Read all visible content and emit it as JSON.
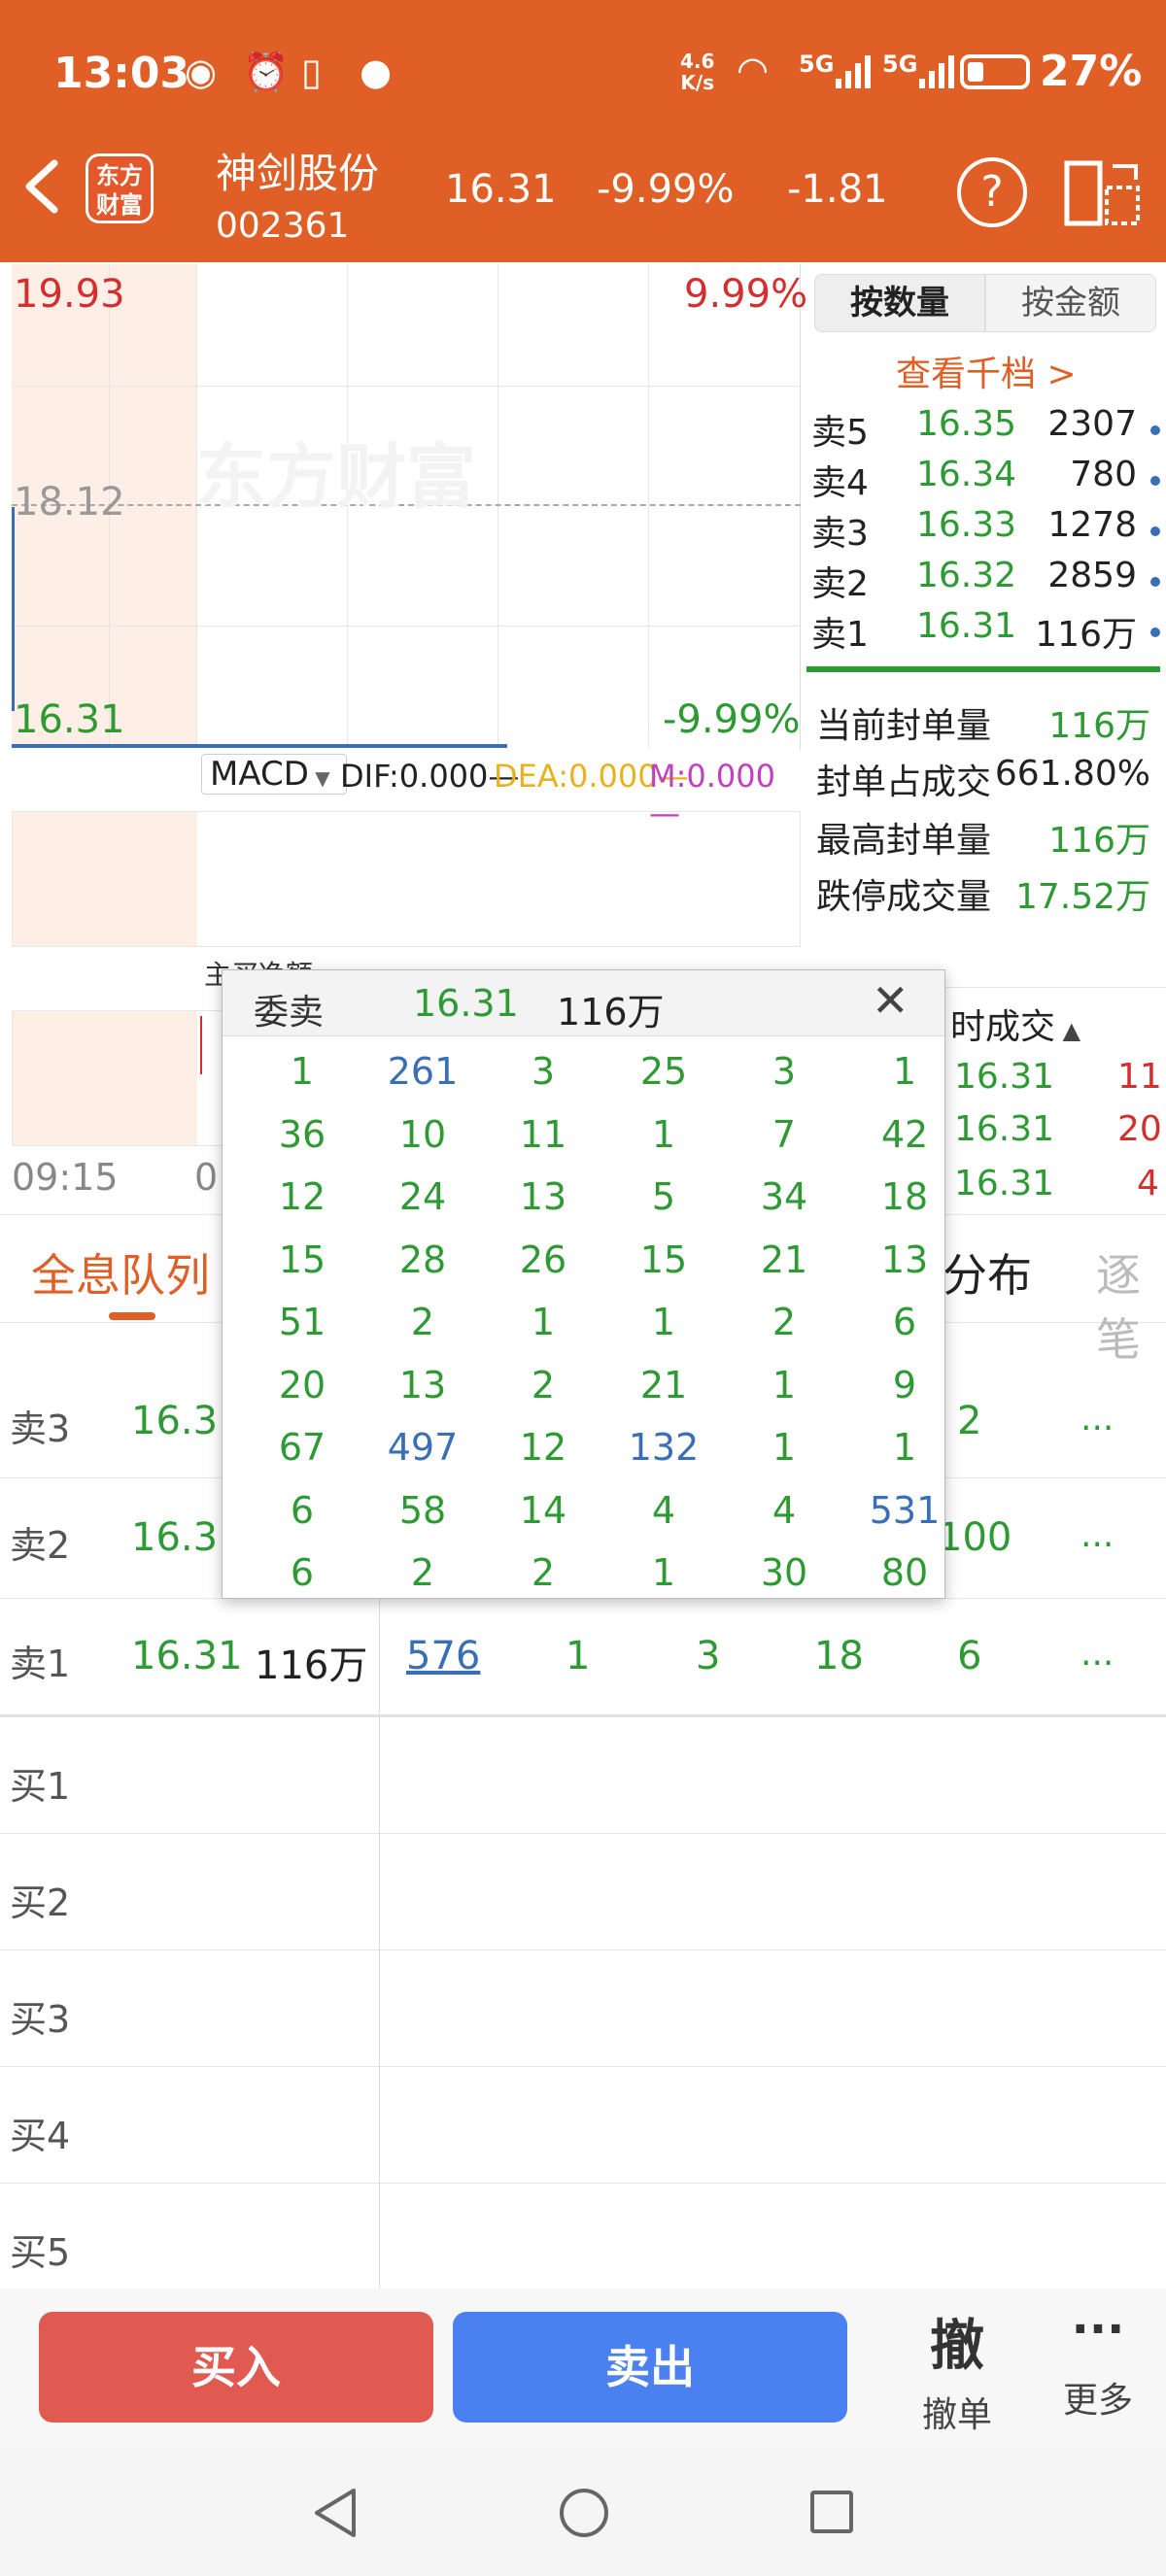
{
  "status_bar": {
    "time": "13:03",
    "net_speed_top": "4.6",
    "net_speed_bottom": "K/s",
    "sim1": "5G",
    "sim2": "5G",
    "battery": "27%"
  },
  "header": {
    "logo_line1": "东方",
    "logo_line2": "财富",
    "stock_name": "神剑股份",
    "stock_code": "002361",
    "price": "16.31",
    "change_pct": "-9.99%",
    "change": "-1.81",
    "help": "?"
  },
  "chart": {
    "y_high": "19.93",
    "y_mid": "18.12",
    "y_low": "16.31",
    "pct_high": "9.99%",
    "pct_low": "-9.99%",
    "watermark": "东方财富",
    "time_start": "09:15",
    "time_partial": "0",
    "indicator": "MACD",
    "dif": "DIF:0.000—",
    "dea": "DEA:0.000—",
    "m": "M:0.000—",
    "sub_partial": "主买净额"
  },
  "orderbook": {
    "tab_qty": "按数量",
    "tab_amt": "按金额",
    "view_link": "查看千档 >",
    "rows": [
      {
        "label": "卖5",
        "price": "16.35",
        "vol": "2307"
      },
      {
        "label": "卖4",
        "price": "16.34",
        "vol": "780"
      },
      {
        "label": "卖3",
        "price": "16.33",
        "vol": "1278"
      },
      {
        "label": "卖2",
        "price": "16.32",
        "vol": "2859"
      },
      {
        "label": "卖1",
        "price": "16.31",
        "vol": "116万"
      }
    ],
    "stats": [
      {
        "label": "当前封单量",
        "value": "116万"
      },
      {
        "label": "封单占成交",
        "value": "661.80%"
      },
      {
        "label": "最高封单量",
        "value": "116万"
      },
      {
        "label": "跌停成交量",
        "value": "17.52万"
      }
    ]
  },
  "realtime": {
    "title": "时成交",
    "rows": [
      {
        "price": "16.31",
        "vol": "11"
      },
      {
        "price": "16.31",
        "vol": "20"
      },
      {
        "price": "16.31",
        "vol": "4"
      }
    ]
  },
  "tabs": {
    "active": "全息队列",
    "mid": "分布",
    "right": "逐笔"
  },
  "queue": {
    "rows": [
      {
        "label": "卖3",
        "price": "16.3",
        "right": "2",
        "more": "..."
      },
      {
        "label": "卖2",
        "price": "16.3",
        "right": "100",
        "more": "..."
      },
      {
        "label": "卖1",
        "price": "16.31",
        "vol": "116万",
        "q1": "576",
        "q2": "1",
        "q3": "3",
        "q4": "18",
        "q5": "6",
        "more": "..."
      }
    ],
    "buy_rows": [
      "买1",
      "买2",
      "买3",
      "买4",
      "买5"
    ]
  },
  "popup": {
    "title": "委卖",
    "price": "16.31",
    "vol": "116万",
    "close": "✕",
    "cells": [
      [
        "1",
        "261",
        "3",
        "25",
        "3",
        "1"
      ],
      [
        "36",
        "10",
        "11",
        "1",
        "7",
        "42"
      ],
      [
        "12",
        "24",
        "13",
        "5",
        "34",
        "18"
      ],
      [
        "15",
        "28",
        "26",
        "15",
        "21",
        "13"
      ],
      [
        "51",
        "2",
        "1",
        "1",
        "2",
        "6"
      ],
      [
        "20",
        "13",
        "2",
        "21",
        "1",
        "9"
      ],
      [
        "67",
        "497",
        "12",
        "132",
        "1",
        "1"
      ],
      [
        "6",
        "58",
        "14",
        "4",
        "4",
        "531"
      ],
      [
        "6",
        "2",
        "2",
        "1",
        "30",
        "80"
      ]
    ],
    "blue_cells": [
      "0-1",
      "6-1",
      "6-3",
      "7-5"
    ]
  },
  "bottom": {
    "buy": "买入",
    "sell": "卖出",
    "cancel_icon": "撤",
    "cancel": "撤单",
    "more_icon": "···",
    "more": "更多"
  },
  "colors": {
    "header": "#df5f27",
    "up": "#d32f2f",
    "down": "#2e9a33",
    "link": "#3a6fb5",
    "buy": "#e05a52",
    "sell": "#4a80f0"
  }
}
